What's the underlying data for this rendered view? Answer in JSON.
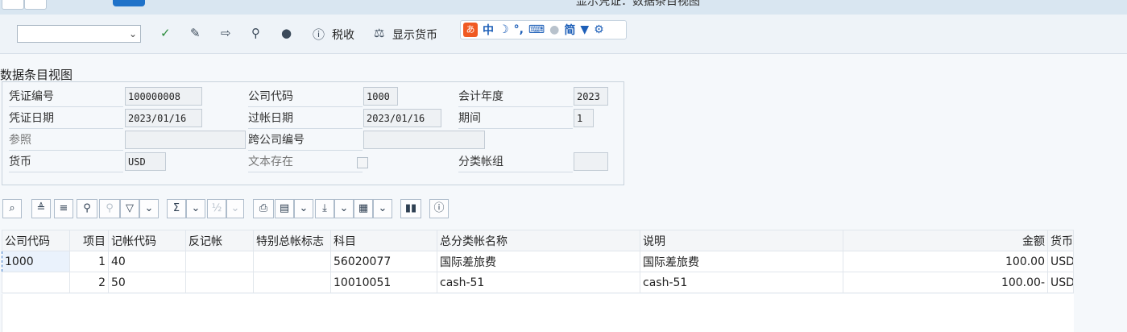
{
  "window": {
    "title": "显示凭证：数据条目视图"
  },
  "toolbar": {
    "combo_value": "",
    "tax_label": "税收",
    "currency_label": "显示货币"
  },
  "ime": {
    "logo": "あ",
    "zh": "中",
    "simplified": "简"
  },
  "section_title": "数据条目视图",
  "header": {
    "doc_no_label": "凭证编号",
    "doc_no": "100000008",
    "company_code_label": "公司代码",
    "company_code": "1000",
    "fiscal_year_label": "会计年度",
    "fiscal_year": "2023",
    "doc_date_label": "凭证日期",
    "doc_date": "2023/01/16",
    "posting_date_label": "过帐日期",
    "posting_date": "2023/01/16",
    "period_label": "期间",
    "period": "1",
    "reference_label": "参照",
    "reference": "",
    "cross_company_label": "跨公司编号",
    "cross_company": "",
    "currency_label": "货币",
    "currency": "USD",
    "text_exists_label": "文本存在",
    "ledger_group_label": "分类帐组",
    "ledger_group": ""
  },
  "grid": {
    "columns": [
      "公司代码",
      "项目",
      "记帐代码",
      "反记帐",
      "特别总帐标志",
      "科目",
      "总分类帐名称",
      "说明",
      "金额",
      "货币"
    ],
    "rows": [
      {
        "company": "1000",
        "item": "1",
        "posting_key": "40",
        "reversal": "",
        "special_gl": "",
        "account": "56020077",
        "gl_name": "国际差旅费",
        "desc": "国际差旅费",
        "amount": "100.00",
        "currency": "USD"
      },
      {
        "company": "",
        "item": "2",
        "posting_key": "50",
        "reversal": "",
        "special_gl": "",
        "account": "10010051",
        "gl_name": "cash-51",
        "desc": "cash-51",
        "amount": "100.00-",
        "currency": "USD"
      }
    ]
  }
}
